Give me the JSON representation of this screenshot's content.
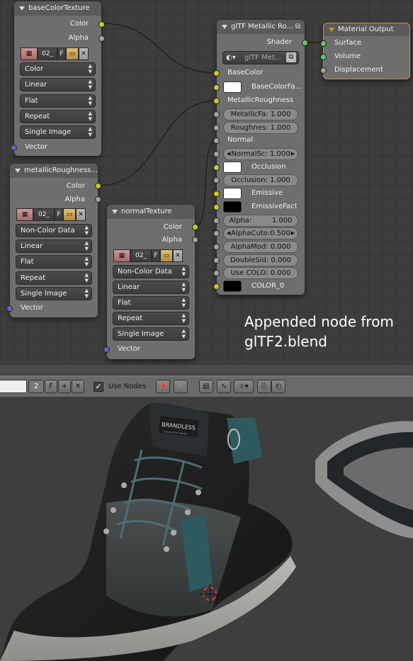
{
  "nodes": {
    "base_color_texture": {
      "title": "baseColorTexture",
      "out_color": "Color",
      "out_alpha": "Alpha",
      "image_frame": "02_",
      "image_f": "F",
      "color_space": "Color",
      "interpolation": "Linear",
      "projection": "Flat",
      "extension": "Repeat",
      "source": "Single Image",
      "in_vector": "Vector"
    },
    "metallic_roughness_texture": {
      "title": "metallicRoughness...",
      "out_color": "Color",
      "out_alpha": "Alpha",
      "image_frame": "02_",
      "image_f": "F",
      "color_space": "Non-Color Data",
      "interpolation": "Linear",
      "projection": "Flat",
      "extension": "Repeat",
      "source": "Single Image",
      "in_vector": "Vector"
    },
    "normal_texture": {
      "title": "normalTexture",
      "out_color": "Color",
      "out_alpha": "Alpha",
      "image_frame": "02_",
      "image_f": "F",
      "color_space": "Non-Color Data",
      "interpolation": "Linear",
      "projection": "Flat",
      "extension": "Repeat",
      "source": "Single Image",
      "in_vector": "Vector"
    },
    "gltf_group": {
      "title": "glTF Metallic Ro...",
      "out_shader": "Shader",
      "group_name": "glTF Met...",
      "inputs": {
        "base_color": "BaseColor",
        "base_color_factor": "BaseColorFa...",
        "metallic_roughness": "MetallicRoughness",
        "metallic_factor": "MetallicFa: 1.000",
        "roughness_factor": "Roughnes: 1.000",
        "normal": "Normal",
        "normal_scale": "NormalSc: 1.000",
        "occlusion": "Occlusion",
        "occlusion_factor": "Occlusion: 1.000",
        "emissive": "Emissive",
        "emissive_factor": "EmissiveFact",
        "alpha": "Alpha:         1.000",
        "alpha_cutoff": "AlphaCuto:0.500",
        "alpha_mode": "AlphaMod: 0.000",
        "double_sided": "DoubleSid: 0.000",
        "use_color0": "Use COLO: 0.000",
        "color0": "COLOR_0"
      }
    },
    "material_output": {
      "title": "Material Output",
      "surface": "Surface",
      "volume": "Volume",
      "displacement": "Displacement"
    }
  },
  "annotation": {
    "line1": "Appended node from",
    "line2": "glTF2.blend"
  },
  "toolbar": {
    "user_count": "2",
    "fake_user": "F",
    "use_nodes_label": "Use Nodes",
    "use_nodes_checked": true
  },
  "viewport": {
    "shoe_brand": "BRANDLESS",
    "shoe_tag": "casual shoe design"
  },
  "colors": {
    "socket_color": "#c7c729",
    "socket_gray": "#a1a1a1",
    "socket_vector": "#6363c7",
    "socket_shader": "#63c763",
    "output_header": "#e0882d"
  }
}
